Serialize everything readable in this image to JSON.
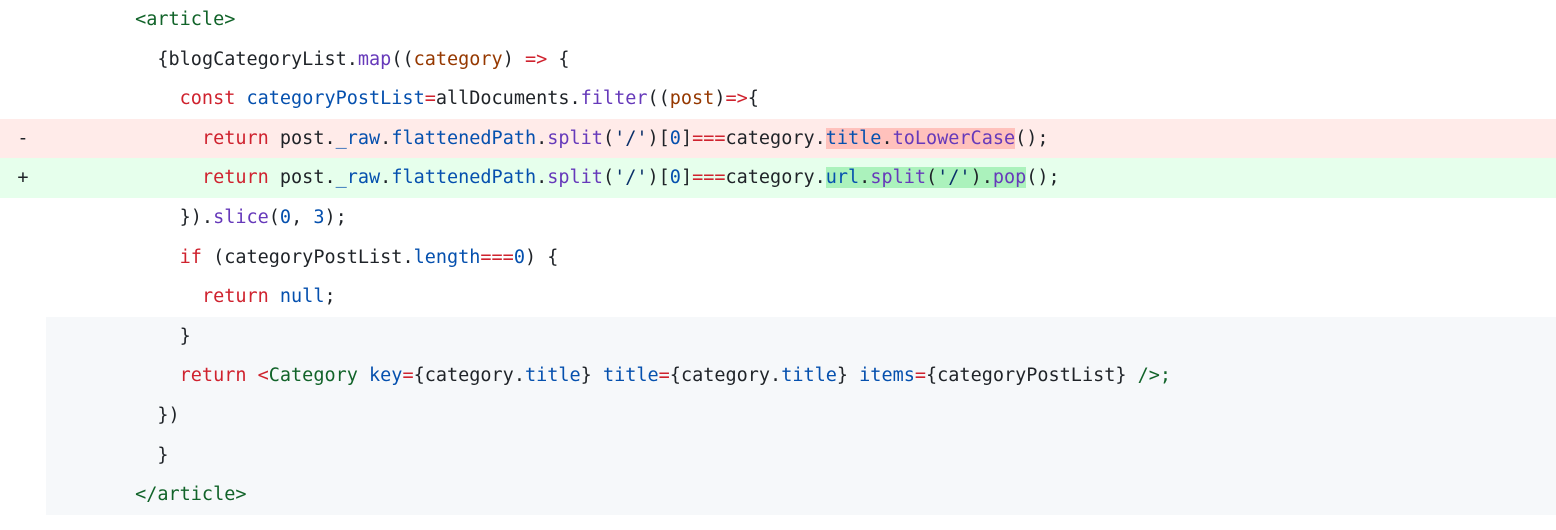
{
  "diff": {
    "signs": {
      "minus": "-",
      "plus": "+"
    },
    "lines": {
      "l1": {
        "indent": "        ",
        "openTag": "<article>"
      },
      "l2": {
        "indent": "          ",
        "braceOpen": "{",
        "ident": "blogCategoryList",
        "dot1": ".",
        "map": "map",
        "argsOpen": "((",
        "param": "category",
        "argsClose": ") ",
        "arrow": "=>",
        "space": " ",
        "curly": "{"
      },
      "l3": {
        "indent": "            ",
        "const": "const",
        "sp1": " ",
        "varName": "categoryPostList",
        "eq": "=",
        "allDocs": "allDocuments",
        "dot": ".",
        "filter": "filter",
        "open": "((",
        "post": "post",
        "close": ")",
        "arrow": "=>",
        "curly": "{"
      },
      "l4": {
        "indent": "              ",
        "return": "return",
        "sp": " ",
        "post": "post",
        "dot1": ".",
        "raw": "_raw",
        "dot2": ".",
        "flattened": "flattenedPath",
        "dot3": ".",
        "split": "split",
        "lp1": "(",
        "slash": "'/'",
        "rp1": ")[",
        "zero": "0",
        "rb": "]",
        "eqeq": "===",
        "cat": "category",
        "dot4": ".",
        "title": "title",
        "dot5": ".",
        "lower": "toLowerCase",
        "tail": "();"
      },
      "l5": {
        "indent": "              ",
        "return": "return",
        "sp": " ",
        "post": "post",
        "dot1": ".",
        "raw": "_raw",
        "dot2": ".",
        "flattened": "flattenedPath",
        "dot3": ".",
        "split": "split",
        "lp1": "(",
        "slash": "'/'",
        "rp1": ")[",
        "zero": "0",
        "rb": "]",
        "eqeq": "===",
        "cat": "category",
        "dot4": ".",
        "url": "url",
        "dot5": ".",
        "split2": "split",
        "lp2": "(",
        "slash2": "'/'",
        "rp2": ").",
        "pop": "pop",
        "tail": "();"
      },
      "l6": {
        "indent": "            ",
        "closeParen": "}).",
        "slice": "slice",
        "lp": "(",
        "zero": "0",
        "comma": ", ",
        "three": "3",
        "rp": ");"
      },
      "l7": {
        "indent": "            ",
        "if": "if",
        "sp": " ",
        "lp": "(",
        "list": "categoryPostList",
        "dot": ".",
        "length": "length",
        "eqeq": "===",
        "zero": "0",
        "rp": ") {"
      },
      "l8": {
        "indent": "              ",
        "return": "return",
        "sp": " ",
        "null": "null",
        "semi": ";"
      },
      "l9": {
        "indent": "            ",
        "brace": "}"
      },
      "l10": {
        "indent": "            ",
        "return": "return",
        "sp": " ",
        "lt": "<",
        "Comp": "Category",
        "sp2": " ",
        "keyAttr": "key",
        "eq1": "=",
        "lb1": "{",
        "cat1": "category",
        "dot1": ".",
        "title1": "title",
        "rb1": "}",
        "sp3": " ",
        "titleAttr": "title",
        "eq2": "=",
        "lb2": "{",
        "cat2": "category",
        "dot2": ".",
        "title2": "title",
        "rb2": "}",
        "sp4": " ",
        "itemsAttr": "items",
        "eq3": "=",
        "lb3": "{",
        "list": "categoryPostList",
        "rb3": "}",
        "close": " />;"
      },
      "l11": {
        "indent": "          ",
        "text": "})"
      },
      "l12": {
        "indent": "          ",
        "text": "}"
      },
      "l13": {
        "indent": "        ",
        "closeTag": "</article>"
      }
    }
  }
}
